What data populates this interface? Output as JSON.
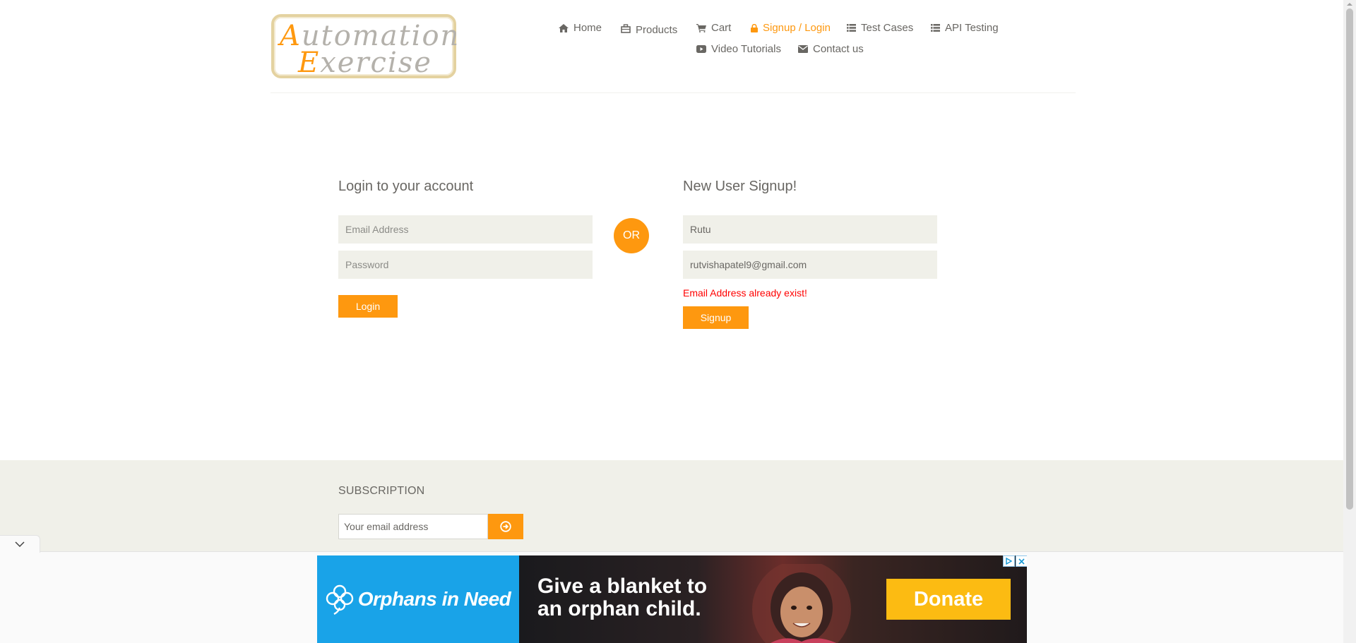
{
  "brand": {
    "logo_line1_cap": "A",
    "logo_line1_rest": "utomation",
    "logo_line2_cap": "E",
    "logo_line2_rest": "xercise"
  },
  "nav": {
    "home": "Home",
    "products": "Products",
    "cart": "Cart",
    "signup_login": "Signup / Login",
    "test_cases": "Test Cases",
    "api_testing": "API Testing",
    "video_tutorials": "Video Tutorials",
    "contact_us": "Contact us"
  },
  "login": {
    "title": "Login to your account",
    "email_placeholder": "Email Address",
    "password_placeholder": "Password",
    "button": "Login"
  },
  "or_label": "OR",
  "signup": {
    "title": "New User Signup!",
    "name_value": "Rutu",
    "email_value": "rutvishapatel9@gmail.com",
    "error": "Email Address already exist!",
    "button": "Signup"
  },
  "subscription": {
    "title": "SUBSCRIPTION",
    "email_placeholder": "Your email address"
  },
  "ad": {
    "org_name": "Orphans in Need",
    "headline_line1": "Give a blanket to",
    "headline_line2": "an orphan child.",
    "donate_label": "Donate"
  },
  "colors": {
    "accent": "#fe980f",
    "text": "#696763",
    "field_bg": "#f0f0e9",
    "error": "#ff0000",
    "ad_blue": "#19a3e8",
    "donate": "#fcbb12"
  },
  "icons": {
    "home": "home-icon",
    "products": "products-icon",
    "cart": "cart-icon",
    "signup": "lock-icon",
    "test_cases": "list-icon",
    "api": "list-icon",
    "video": "youtube-icon",
    "contact": "envelope-icon",
    "subscribe": "arrow-circle-right-icon",
    "ad_toggle": "chevron-down-icon"
  }
}
